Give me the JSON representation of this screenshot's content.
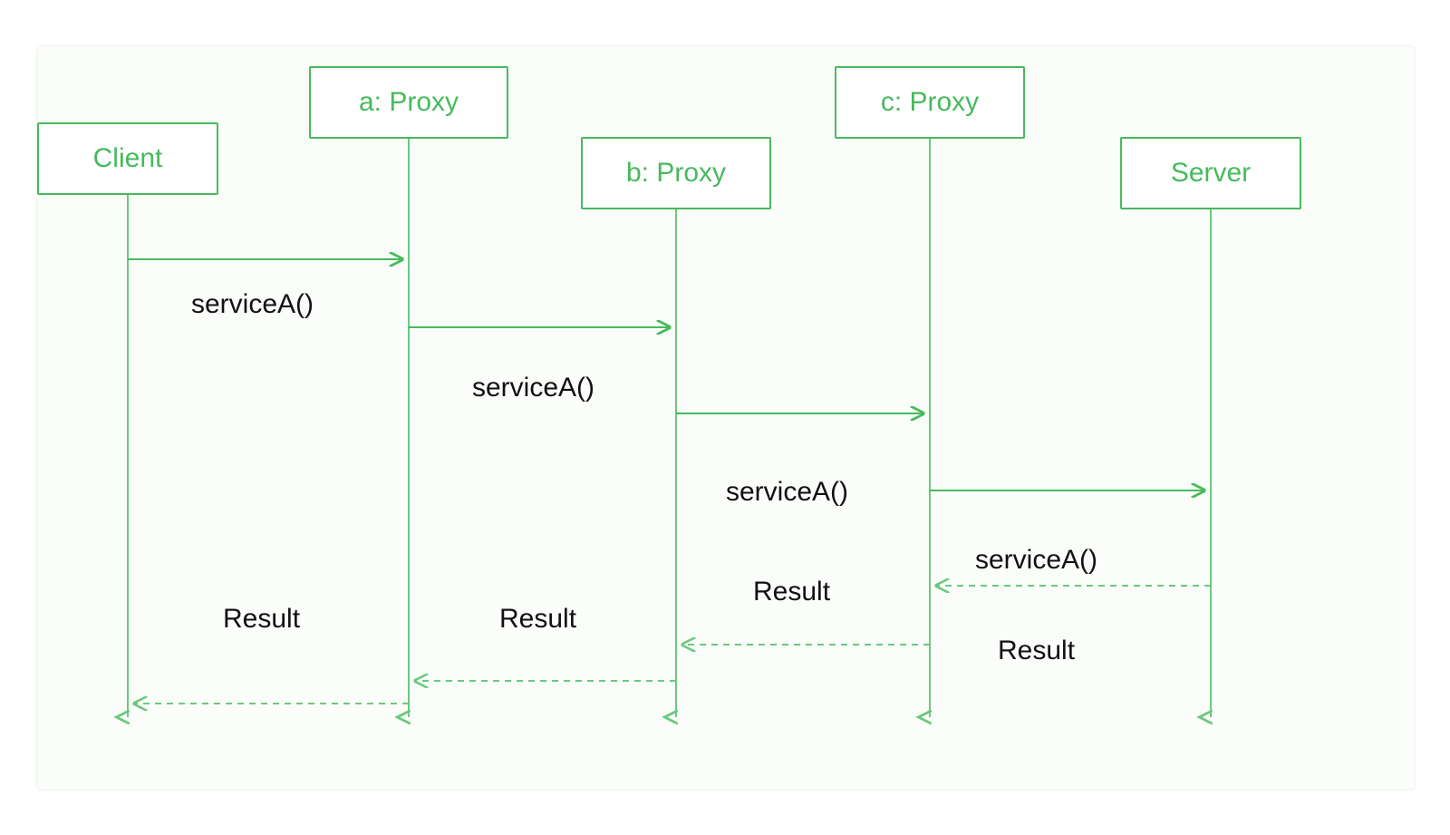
{
  "diagram": {
    "type": "sequence",
    "participants": [
      {
        "id": "client",
        "label": "Client"
      },
      {
        "id": "proxy_a",
        "label": "a: Proxy"
      },
      {
        "id": "proxy_b",
        "label": "b: Proxy"
      },
      {
        "id": "proxy_c",
        "label": "c: Proxy"
      },
      {
        "id": "server",
        "label": "Server"
      }
    ],
    "messages": [
      {
        "from": "client",
        "to": "proxy_a",
        "label": "serviceA()",
        "kind": "call"
      },
      {
        "from": "proxy_a",
        "to": "proxy_b",
        "label": "serviceA()",
        "kind": "call"
      },
      {
        "from": "proxy_b",
        "to": "proxy_c",
        "label": "serviceA()",
        "kind": "call"
      },
      {
        "from": "proxy_c",
        "to": "server",
        "label": "serviceA()",
        "kind": "call"
      },
      {
        "from": "server",
        "to": "proxy_c",
        "label": "Result",
        "kind": "return"
      },
      {
        "from": "proxy_c",
        "to": "proxy_b",
        "label": "Result",
        "kind": "return"
      },
      {
        "from": "proxy_b",
        "to": "proxy_a",
        "label": "Result",
        "kind": "return"
      },
      {
        "from": "proxy_a",
        "to": "client",
        "label": "Result",
        "kind": "return"
      }
    ],
    "colors": {
      "stroke": "#47ba5c",
      "text": "#111111"
    }
  }
}
